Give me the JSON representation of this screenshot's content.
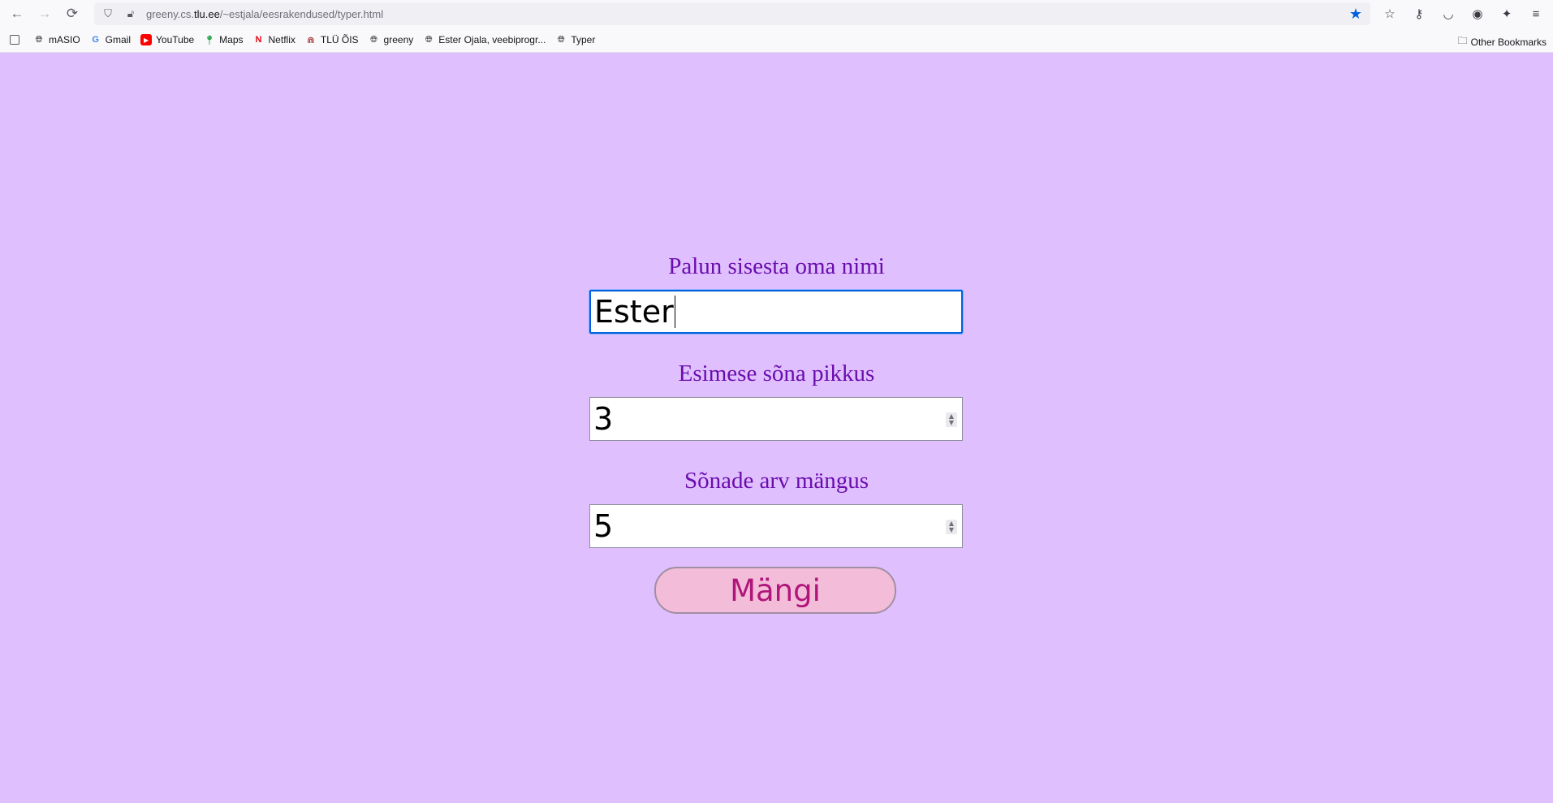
{
  "browser": {
    "url_prefix": "greeny.cs.",
    "url_host": "tlu.ee",
    "url_path": "/~estjala/eesrakendused/typer.html"
  },
  "bookmarks": [
    {
      "label": "mASIO",
      "icon": "globe-icon"
    },
    {
      "label": "Gmail",
      "icon": "google-icon"
    },
    {
      "label": "YouTube",
      "icon": "youtube-icon"
    },
    {
      "label": "Maps",
      "icon": "maps-pin-icon"
    },
    {
      "label": "Netflix",
      "icon": "netflix-icon"
    },
    {
      "label": "TLÜ ÕIS",
      "icon": "tlu-icon"
    },
    {
      "label": "greeny",
      "icon": "globe-icon"
    },
    {
      "label": "Ester Ojala, veebiprogr...",
      "icon": "globe-icon"
    },
    {
      "label": "Typer",
      "icon": "globe-icon"
    }
  ],
  "other_bookmarks": "Other Bookmarks",
  "form": {
    "name_label": "Palun sisesta oma nimi",
    "name_value": "Ester",
    "word_length_label": "Esimese sõna pikkus",
    "word_length_value": "3",
    "word_count_label": "Sõnade arv mängus",
    "word_count_value": "5",
    "play_button": "Mängi"
  },
  "colors": {
    "page_background": "#e0bfff",
    "label_color": "#6a0dad",
    "button_background": "#f3bcd9",
    "button_text": "#b0157a"
  }
}
